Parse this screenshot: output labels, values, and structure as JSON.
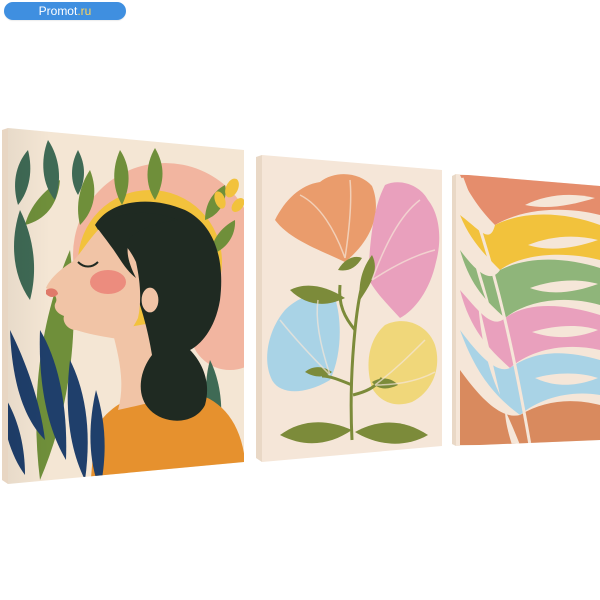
{
  "watermark": {
    "name": "Promot",
    "tld": ".ru"
  },
  "colors": {
    "watermark_bg": "#3f8fe0",
    "canvas_cream": "#f4e6d4",
    "skin": "#f1c4a6",
    "hair": "#1f2a22",
    "shirt": "#e6912e",
    "leaf_dark": "#1f3f6b",
    "leaf_green": "#6f8f3a",
    "leaf_teal": "#3f6a55",
    "sun_pink": "#f2b5a0",
    "sun_yellow": "#f2c23c",
    "petal_orange": "#ea9c6c",
    "petal_pink": "#e9a0bd",
    "petal_blue": "#a9d3e6",
    "petal_yellow": "#f0d77a",
    "stem_olive": "#7c8b3a"
  },
  "panels": [
    {
      "subject": "woman-profile-with-leaves"
    },
    {
      "subject": "four-stylized-flowers"
    },
    {
      "subject": "rainbow-monstera-leaf"
    }
  ]
}
